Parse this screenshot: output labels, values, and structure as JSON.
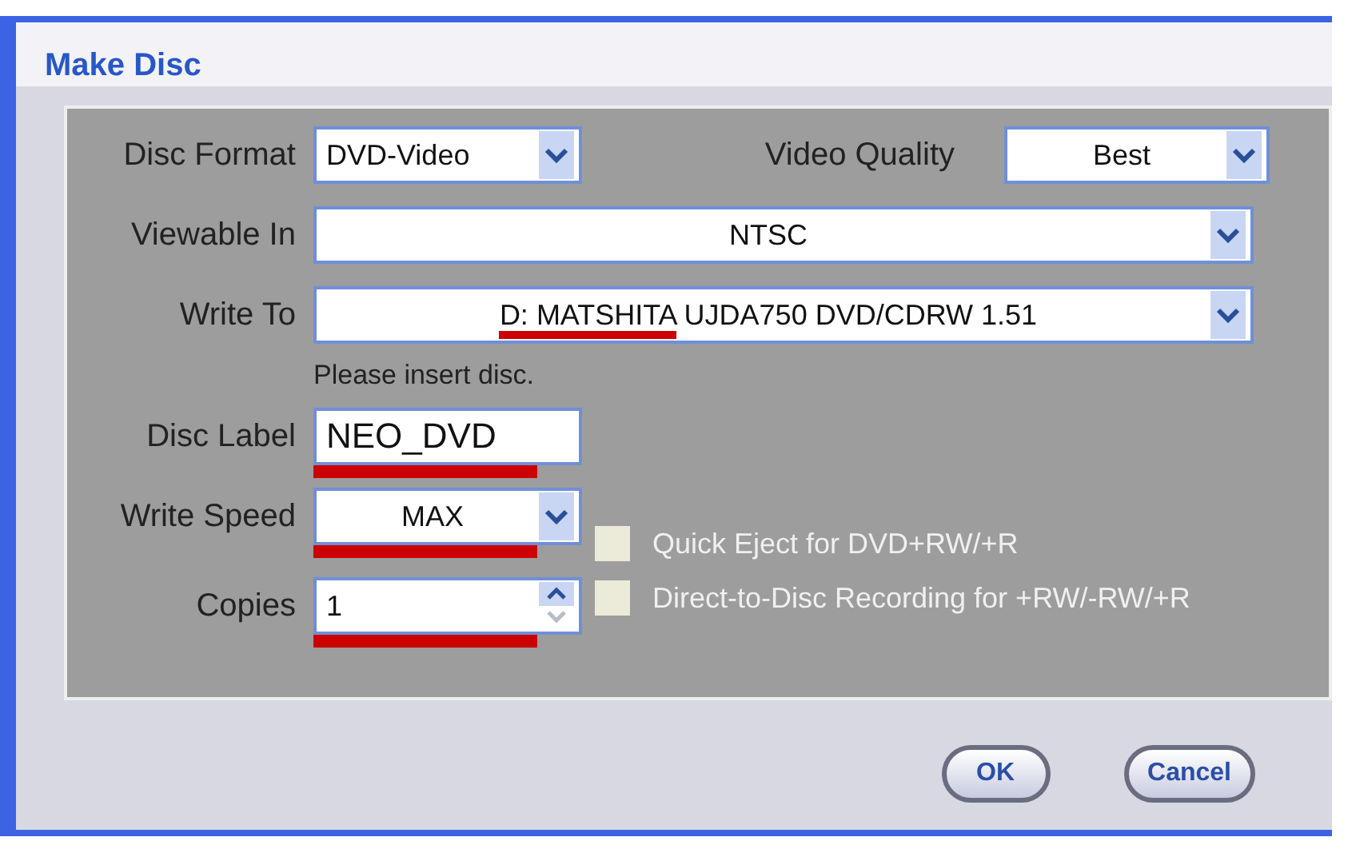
{
  "window": {
    "title": "Make Disc"
  },
  "disc_format": {
    "label": "Disc Format",
    "value": "DVD-Video"
  },
  "video_quality": {
    "label": "Video Quality",
    "value": "Best"
  },
  "viewable_in": {
    "label": "Viewable In",
    "value": "NTSC"
  },
  "write_to": {
    "label": "Write To",
    "value_parts": [
      {
        "text": "D: MATSHITA",
        "underlined": true
      },
      {
        "text": "UJDA750 DVD/CDRW 1.51",
        "underlined": false
      }
    ]
  },
  "message": "Please insert disc.",
  "disc_label": {
    "label": "Disc Label",
    "value": "NEO_DVD",
    "underlined": true
  },
  "write_speed": {
    "label": "Write Speed",
    "value": "MAX",
    "underlined": true
  },
  "copies": {
    "label": "Copies",
    "value": "1",
    "underlined": true
  },
  "options": [
    {
      "label": "Quick Eject for DVD+RW/+R",
      "checked": false,
      "disabled": true
    },
    {
      "label": "Direct-to-Disc Recording for +RW/-RW/+R",
      "checked": false,
      "disabled": true
    }
  ],
  "buttons": [
    "OK",
    "Cancel"
  ]
}
